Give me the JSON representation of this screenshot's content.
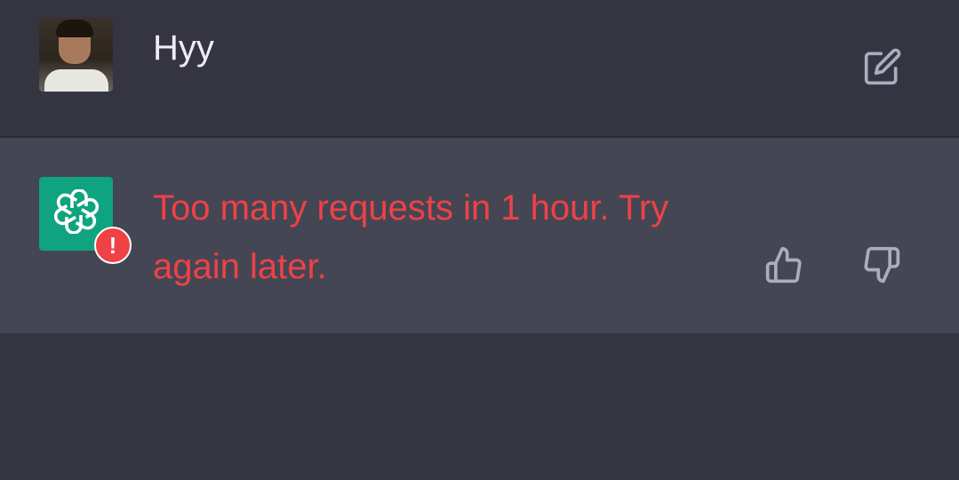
{
  "conversation": {
    "user_message": {
      "text": "Hyy",
      "avatar_icon": "user-photo-avatar",
      "edit_icon": "edit-icon"
    },
    "assistant_message": {
      "text": "Too many requests in 1 hour. Try again later.",
      "avatar_icon": "openai-logo-icon",
      "badge_text": "!",
      "thumbs_up_icon": "thumbs-up-icon",
      "thumbs_down_icon": "thumbs-down-icon"
    }
  },
  "colors": {
    "background": "#343541",
    "assistant_background": "#444654",
    "error_text": "#ef4146",
    "user_text": "#ececf1",
    "bot_avatar": "#10a37f",
    "icon": "#acacbe"
  }
}
